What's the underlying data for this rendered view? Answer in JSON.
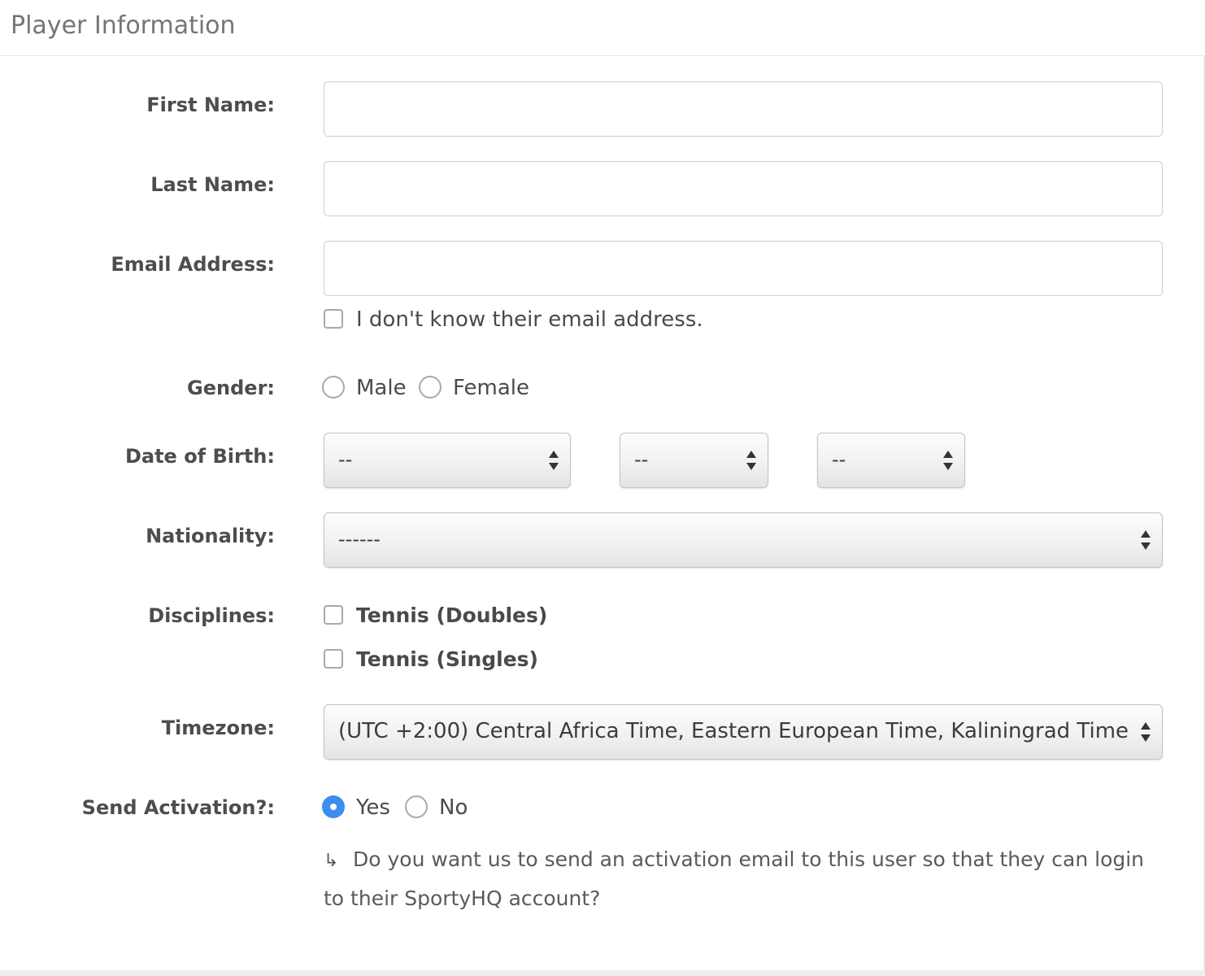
{
  "panel": {
    "title": "Player Information"
  },
  "fields": {
    "first_name": {
      "label": "First Name:",
      "value": ""
    },
    "last_name": {
      "label": "Last Name:",
      "value": ""
    },
    "email": {
      "label": "Email Address:",
      "value": "",
      "unknown_checkbox_label": "I don't know their email address.",
      "unknown_checked": false
    },
    "gender": {
      "label": "Gender:",
      "options": [
        "Male",
        "Female"
      ],
      "selected": null
    },
    "dob": {
      "label": "Date of Birth:",
      "month": "--",
      "day": "--",
      "year": "--"
    },
    "nationality": {
      "label": "Nationality:",
      "value": "------"
    },
    "disciplines": {
      "label": "Disciplines:",
      "options": [
        "Tennis (Doubles)",
        "Tennis (Singles)"
      ],
      "checked": [
        false,
        false
      ]
    },
    "timezone": {
      "label": "Timezone:",
      "value": "(UTC +2:00) Central Africa Time, Eastern European Time, Kaliningrad Time"
    },
    "send_activation": {
      "label": "Send Activation?:",
      "options": [
        "Yes",
        "No"
      ],
      "selected": "Yes",
      "help_icon": "return-arrow-icon",
      "help_text": "Do you want us to send an activation email to this user so that they can login to their SportyHQ account?"
    }
  },
  "colors": {
    "accent": "#3b8df0"
  }
}
